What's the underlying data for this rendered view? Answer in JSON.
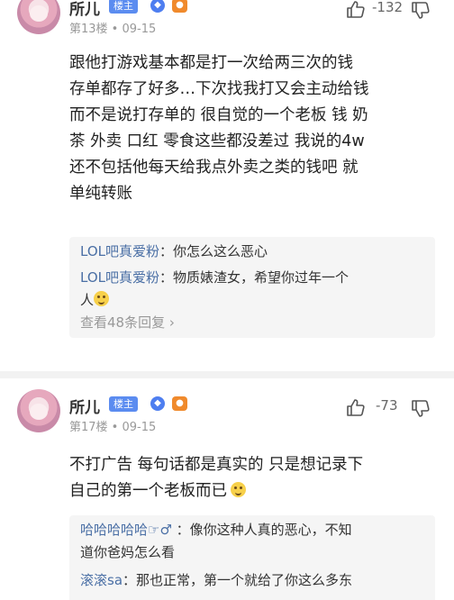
{
  "posts": [
    {
      "author": "所儿",
      "badge": "楼主",
      "meta": "第13楼 • 09-15",
      "like_count": "-132",
      "body_lines": [
        "跟他打游戏基本都是打一次给两三次的钱",
        "存单都存了好多…下次找我打又会主动给钱",
        "而不是说打存单的 很自觉的一个老板 钱 奶",
        "茶 外卖 口红 零食这些都没差过 我说的4w",
        "还不包括他每天给我点外卖之类的钱吧 就",
        "单纯转账"
      ],
      "replies": [
        {
          "name": "LOL吧真爱粉",
          "lines": [
            "：你怎么这么恶心"
          ]
        },
        {
          "name": "LOL吧真爱粉",
          "lines": [
            "：物质婊渣女，希望你过年一个",
            "人"
          ]
        }
      ],
      "more": "查看48条回复 ›"
    },
    {
      "author": "所儿",
      "badge": "楼主",
      "meta": "第17楼 • 09-15",
      "like_count": "-73",
      "body_lines": [
        "不打广告 每句话都是真实的 只是想记录下",
        "自己的第一个老板而已"
      ],
      "replies": [
        {
          "name": "哈哈哈哈哈☞♂",
          "lines": [
            " ：像你这种人真的恶心，不知",
            "道你爸妈怎么看"
          ]
        },
        {
          "name": "滚滚sa",
          "lines": [
            "：那也正常，第一个就给了你这么多东"
          ]
        }
      ]
    }
  ],
  "icons": {
    "vip": "vip-shield-icon",
    "game": "game-controller-icon",
    "like": "thumbs-up-icon",
    "dislike": "thumbs-down-icon"
  },
  "colors": {
    "badge": "#5b8cf0",
    "reply_name": "#4a6fa5",
    "meta": "#999999"
  }
}
